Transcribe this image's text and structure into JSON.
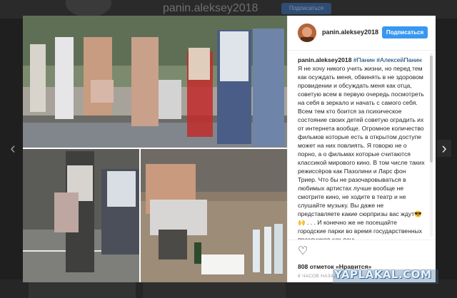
{
  "background": {
    "username": "panin.aleksey2018",
    "follow_label": "Подписаться"
  },
  "navigation": {
    "prev_icon": "chevron-left-icon",
    "next_icon": "chevron-right-icon"
  },
  "post": {
    "username": "panin.aleksey2018",
    "follow_label": "Подписаться",
    "caption_username": "panin.aleksey2018",
    "hashtags": "#Панин #АлексейПанин",
    "caption_text": "Я не хочу никого учить жизни, но перед тем как осуждать меня, обвинять в не здоровом провидении и обсуждать меня как отца, советую всем в первую очередь посмотреть на себя в зеркало и начать с самого себя. Всем тем кто боится за психическое состояние своих детей советую оградить их от интернета вообще. Огромное количество фильмов которые есть в открытом доступе может на них повлиять. Я говорю не о порно, а о фильмах которые считаются классикой мирового кино. В том числе таких режиссёров как Пазолини и Ларс фон Триер. Что бы не разочаровываться в любимых артистах лучше вообще не смотрите кино, не ходите в театр и не слушайте музыку. Вы даже не представляете какие сюрпризы вас ждут😎🙌 . . . И конечно же не посещайте городские парки во время государственных праздников как день",
    "likes_count": "808 отметок",
    "likes_label": "«Нравится»",
    "time_ago": "8 ЧАСОВ НАЗАД",
    "heart_icon": "heart-outline-icon"
  },
  "watermark": "YAPLAKAL.COM",
  "colors": {
    "accent": "#3897f0",
    "hashtag": "#003569",
    "overlay": "#1f1f1f"
  }
}
